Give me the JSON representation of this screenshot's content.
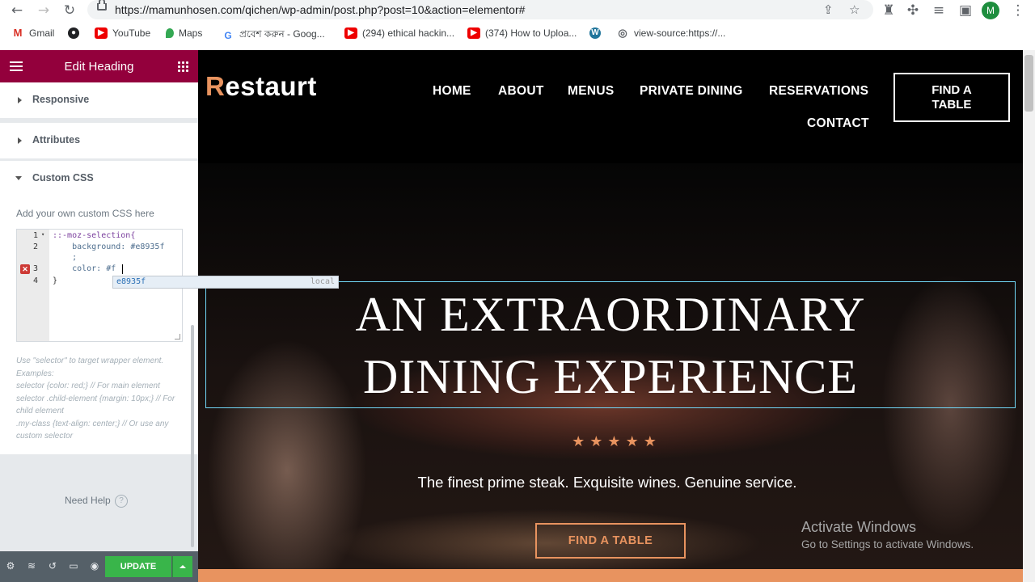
{
  "browser": {
    "url": "https://mamunhosen.com/qichen/wp-admin/post.php?post=10&action=elementor#",
    "profile_initial": "M",
    "bookmarks": [
      "Gmail",
      "YouTube",
      "Maps",
      "প্রবেশ করুন - Goog...",
      "(294) ethical hackin...",
      "(374) How to Uploa...",
      "view-source:https://..."
    ]
  },
  "panel": {
    "title": "Edit Heading",
    "sections": [
      "Responsive",
      "Attributes",
      "Custom CSS"
    ],
    "css_hint": "Add your own custom CSS here",
    "code": {
      "line_numbers": [
        "1",
        "2",
        "3",
        "4"
      ],
      "lines": [
        "::-moz-selection{",
        "    background: #e8935f",
        "    ;",
        "    color: #f",
        "}"
      ],
      "autocomplete_value": "e8935f",
      "autocomplete_meta": "local"
    },
    "help_text": "Use \"selector\" to target wrapper element. Examples:\nselector {color: red;} // For main element\nselector .child-element {margin: 10px;} // For child element\n.my-class {text-align: center;} // Or use any custom selector",
    "need_help": "Need Help",
    "update_label": "UPDATE"
  },
  "site": {
    "logo_initial": "R",
    "logo_rest": "estaurt",
    "nav": [
      "HOME",
      "ABOUT",
      "MENUS",
      "PRIVATE DINING",
      "RESERVATIONS",
      "CONTACT"
    ],
    "cta_top": "FIND A TABLE",
    "heading_line1": "AN EXTRAORDINARY",
    "heading_line2": "DINING EXPERIENCE",
    "stars": "★★★★★",
    "rating": 5,
    "tagline": "The finest prime steak. Exquisite wines. Genuine service.",
    "cta_hero": "FIND A TABLE"
  },
  "watermark": {
    "title": "Activate Windows",
    "subtitle": "Go to Settings to activate Windows."
  },
  "colors": {
    "accent": "#e8935f",
    "editor_header": "#93003c",
    "update_green": "#39b54a"
  }
}
